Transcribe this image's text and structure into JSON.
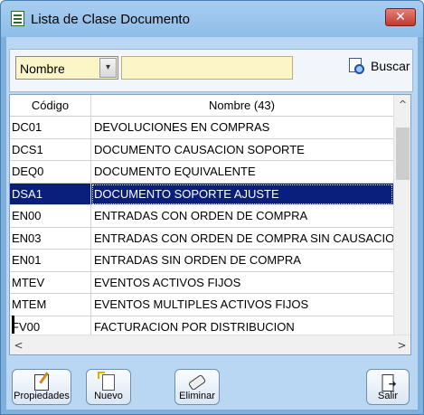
{
  "window": {
    "title": "Lista de Clase Documento",
    "close_symbol": "✕"
  },
  "search": {
    "field_selected": "Nombre",
    "dropdown_arrow": "▾",
    "input_value": "",
    "button_label": "Buscar"
  },
  "grid": {
    "columns": [
      "Código",
      "Nombre (43)"
    ],
    "rows": [
      {
        "code": "DC01",
        "name": "DEVOLUCIONES EN COMPRAS"
      },
      {
        "code": "DCS1",
        "name": "DOCUMENTO CAUSACION SOPORTE"
      },
      {
        "code": "DEQ0",
        "name": "DOCUMENTO EQUIVALENTE"
      },
      {
        "code": "DSA1",
        "name": "DOCUMENTO SOPORTE AJUSTE",
        "selected": true
      },
      {
        "code": "EN00",
        "name": "ENTRADAS CON ORDEN DE COMPRA"
      },
      {
        "code": "EN03",
        "name": "ENTRADAS CON ORDEN DE COMPRA SIN CAUSACION"
      },
      {
        "code": "EN01",
        "name": "ENTRADAS SIN ORDEN DE COMPRA"
      },
      {
        "code": "MTEV",
        "name": "EVENTOS ACTIVOS FIJOS"
      },
      {
        "code": "MTEM",
        "name": "EVENTOS MULTIPLES ACTIVOS FIJOS"
      },
      {
        "code": "FV00",
        "name": "FACTURACION POR DISTRIBUCION"
      }
    ],
    "scroll_up": "^",
    "scroll_left": "<",
    "scroll_right": ">"
  },
  "toolbar": {
    "properties_label": "Propiedades",
    "new_label": "Nuevo",
    "delete_label": "Eliminar",
    "exit_label": "Salir"
  },
  "colors": {
    "selected_row": "#0a1f7a",
    "input_background": "#fbf5c7",
    "client_background": "#b9d6f2"
  }
}
